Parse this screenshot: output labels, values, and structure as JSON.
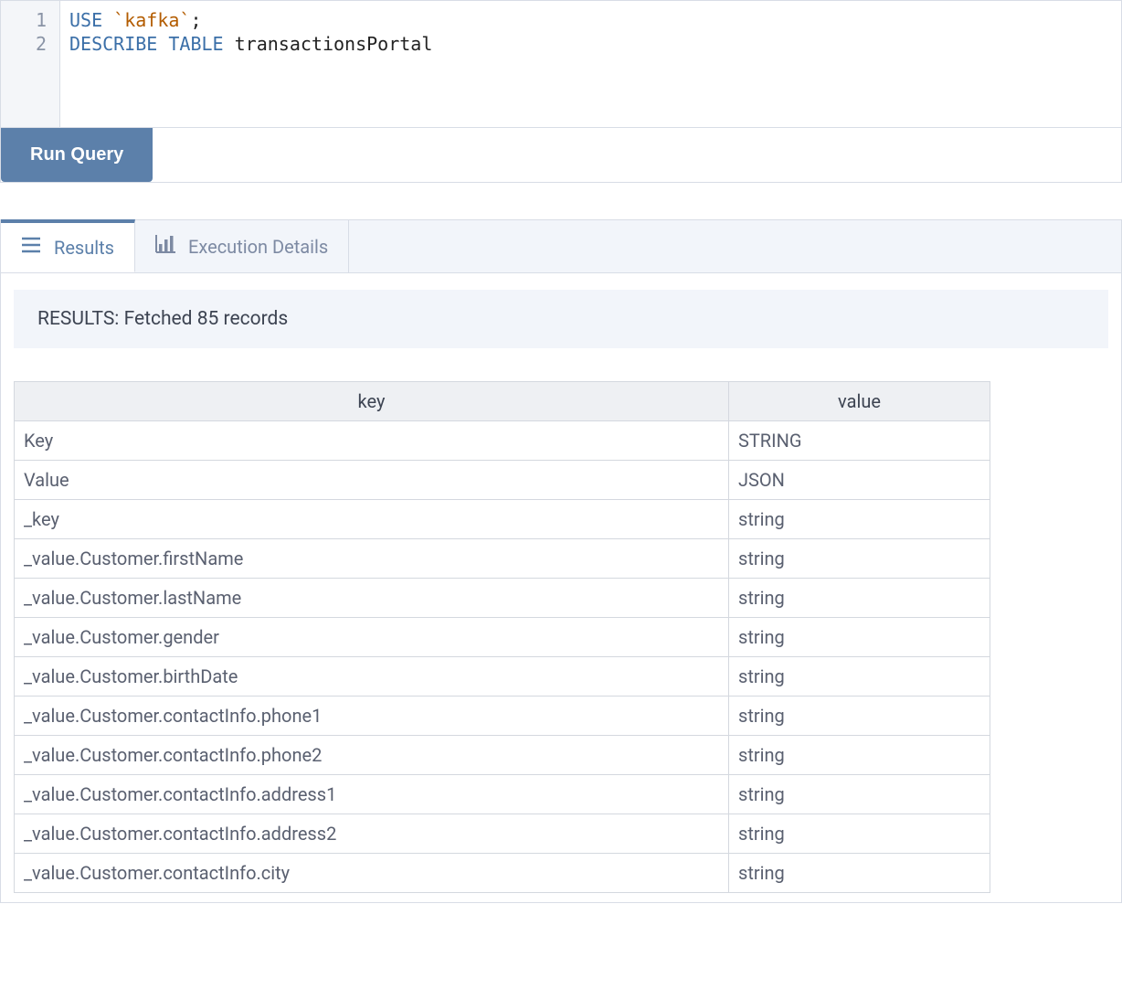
{
  "editor": {
    "lines": [
      {
        "n": "1",
        "tokens": [
          {
            "t": "USE",
            "c": "kw"
          },
          {
            "t": " ",
            "c": ""
          },
          {
            "t": "`kafka`",
            "c": "bt"
          },
          {
            "t": ";",
            "c": "semi"
          }
        ]
      },
      {
        "n": "2",
        "tokens": [
          {
            "t": "DESCRIBE",
            "c": "kw"
          },
          {
            "t": " ",
            "c": ""
          },
          {
            "t": "TABLE",
            "c": "kw"
          },
          {
            "t": " ",
            "c": ""
          },
          {
            "t": "transactionsPortal",
            "c": "ident"
          }
        ]
      }
    ]
  },
  "toolbar": {
    "run_label": "Run Query"
  },
  "tabs": {
    "results_label": "Results",
    "execdetails_label": "Execution Details"
  },
  "results": {
    "status": "RESULTS: Fetched 85 records",
    "columns": {
      "key": "key",
      "value": "value"
    },
    "rows": [
      {
        "key": "Key",
        "value": "STRING"
      },
      {
        "key": "Value",
        "value": "JSON"
      },
      {
        "key": "_key",
        "value": "string"
      },
      {
        "key": "_value.Customer.firstName",
        "value": "string"
      },
      {
        "key": "_value.Customer.lastName",
        "value": "string"
      },
      {
        "key": "_value.Customer.gender",
        "value": "string"
      },
      {
        "key": "_value.Customer.birthDate",
        "value": "string"
      },
      {
        "key": "_value.Customer.contactInfo.phone1",
        "value": "string"
      },
      {
        "key": "_value.Customer.contactInfo.phone2",
        "value": "string"
      },
      {
        "key": "_value.Customer.contactInfo.address1",
        "value": "string"
      },
      {
        "key": "_value.Customer.contactInfo.address2",
        "value": "string"
      },
      {
        "key": "_value.Customer.contactInfo.city",
        "value": "string"
      }
    ]
  }
}
